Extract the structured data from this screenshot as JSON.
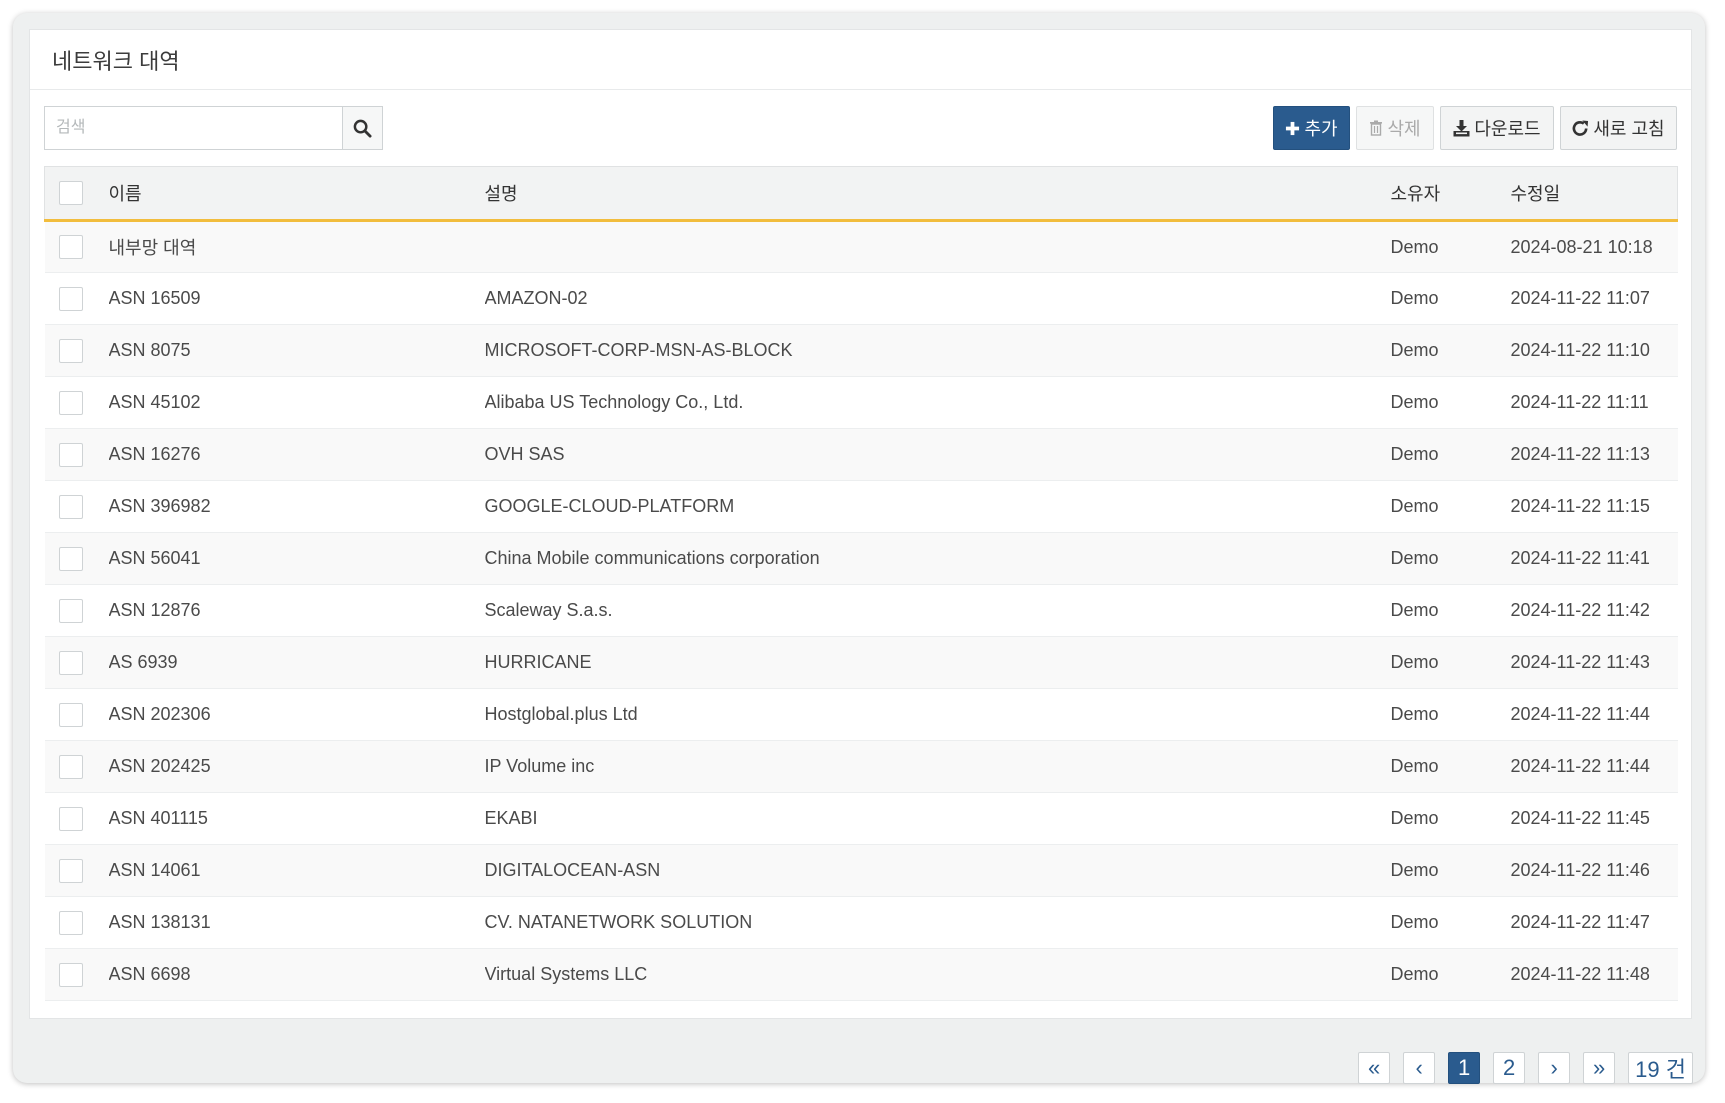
{
  "panel": {
    "title": "네트워크 대역"
  },
  "search": {
    "placeholder": "검색",
    "value": ""
  },
  "toolbar": {
    "add_label": "추가",
    "delete_label": "삭제",
    "download_label": "다운로드",
    "refresh_label": "새로 고침"
  },
  "table": {
    "columns": {
      "name": "이름",
      "description": "설명",
      "owner": "소유자",
      "modified": "수정일"
    },
    "rows": [
      {
        "name": "내부망 대역",
        "description": "",
        "owner": "Demo",
        "modified": "2024-08-21 10:18"
      },
      {
        "name": "ASN 16509",
        "description": "AMAZON-02",
        "owner": "Demo",
        "modified": "2024-11-22 11:07"
      },
      {
        "name": "ASN 8075",
        "description": "MICROSOFT-CORP-MSN-AS-BLOCK",
        "owner": "Demo",
        "modified": "2024-11-22 11:10"
      },
      {
        "name": "ASN 45102",
        "description": "Alibaba US Technology Co., Ltd.",
        "owner": "Demo",
        "modified": "2024-11-22 11:11"
      },
      {
        "name": "ASN 16276",
        "description": "OVH SAS",
        "owner": "Demo",
        "modified": "2024-11-22 11:13"
      },
      {
        "name": "ASN 396982",
        "description": "GOOGLE-CLOUD-PLATFORM",
        "owner": "Demo",
        "modified": "2024-11-22 11:15"
      },
      {
        "name": "ASN 56041",
        "description": "China Mobile communications corporation",
        "owner": "Demo",
        "modified": "2024-11-22 11:41"
      },
      {
        "name": "ASN 12876",
        "description": "Scaleway S.a.s.",
        "owner": "Demo",
        "modified": "2024-11-22 11:42"
      },
      {
        "name": "AS 6939",
        "description": "HURRICANE",
        "owner": "Demo",
        "modified": "2024-11-22 11:43"
      },
      {
        "name": "ASN 202306",
        "description": "Hostglobal.plus Ltd",
        "owner": "Demo",
        "modified": "2024-11-22 11:44"
      },
      {
        "name": "ASN 202425",
        "description": "IP Volume inc",
        "owner": "Demo",
        "modified": "2024-11-22 11:44"
      },
      {
        "name": "ASN 401115",
        "description": "EKABI",
        "owner": "Demo",
        "modified": "2024-11-22 11:45"
      },
      {
        "name": "ASN 14061",
        "description": "DIGITALOCEAN-ASN",
        "owner": "Demo",
        "modified": "2024-11-22 11:46"
      },
      {
        "name": "ASN 138131",
        "description": "CV. NATANETWORK SOLUTION",
        "owner": "Demo",
        "modified": "2024-11-22 11:47"
      },
      {
        "name": "ASN 6698",
        "description": "Virtual Systems LLC",
        "owner": "Demo",
        "modified": "2024-11-22 11:48"
      }
    ]
  },
  "pagination": {
    "first": "«",
    "prev": "‹",
    "pages": [
      "1",
      "2"
    ],
    "current": "1",
    "next": "›",
    "last": "»",
    "total": "19 건"
  },
  "colors": {
    "primary": "#2a5b8e",
    "header_accent": "#f2bd3d"
  },
  "icons": {
    "search": "search-icon",
    "add": "plus-icon",
    "delete": "trash-icon",
    "download": "download-icon",
    "refresh": "refresh-icon"
  }
}
